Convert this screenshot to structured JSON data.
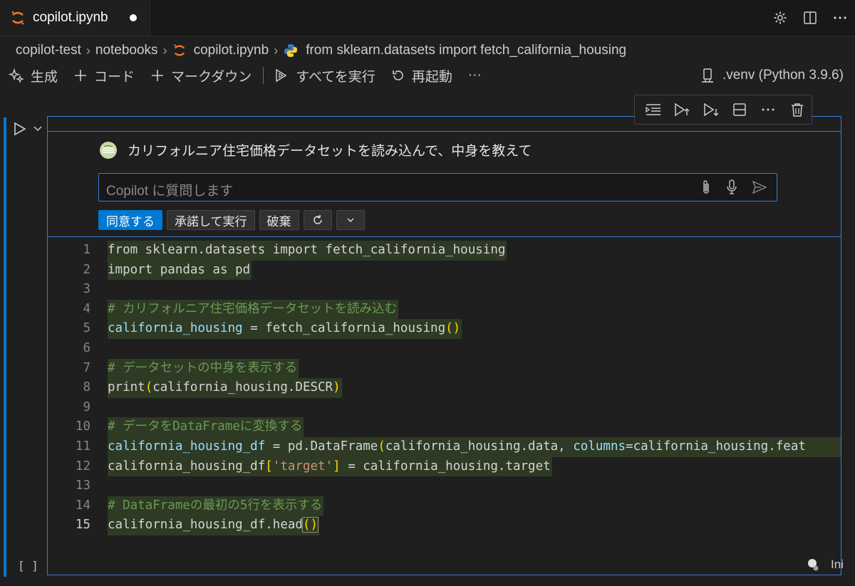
{
  "tab": {
    "title": "copilot.ipynb"
  },
  "breadcrumb": {
    "items": [
      "copilot-test",
      "notebooks",
      "copilot.ipynb",
      "from sklearn.datasets import fetch_california_housing"
    ]
  },
  "toolbar": {
    "generate": "生成",
    "code": "コード",
    "markdown": "マークダウン",
    "run_all": "すべてを実行",
    "restart": "再起動",
    "more": "···"
  },
  "kernel": {
    "label": ".venv (Python 3.9.6)"
  },
  "inline_chat": {
    "prompt": "カリフォルニア住宅価格データセットを読み込んで、中身を教えて",
    "input_placeholder": "Copilot に質問します",
    "accept_label": "同意する",
    "accept_run_label": "承諾して実行",
    "discard_label": "破棄"
  },
  "code": {
    "line_numbers": [
      "1",
      "2",
      "3",
      "4",
      "5",
      "6",
      "7",
      "8",
      "9",
      "10",
      "11",
      "12",
      "13",
      "14",
      "15"
    ],
    "line1": "from sklearn.datasets import fetch_california_housing",
    "line2": "import pandas as pd",
    "line4": "# カリフォルニア住宅価格データセットを読み込む",
    "line5_var": "california_housing",
    "line5_rest": " = fetch_california_housing",
    "line7": "# データセットの中身を表示する",
    "line8_fn": "print",
    "line8_arg": "california_housing.DESCR",
    "line10": "# データをDataFrameに変換する",
    "line11_var": "california_housing_df",
    "line11_mid": " = pd.DataFrame",
    "line11_arg": "california_housing.data, ",
    "line11_kw": "columns",
    "line11_tail": "=california_housing.feat",
    "line12_a": "california_housing_df",
    "line12_str": "'target'",
    "line12_b": " = california_housing.target",
    "line14": "# DataFrameの最初の5行を表示する",
    "line15": "california_housing_df.head"
  },
  "cell_status": "[ ]",
  "language_label": "Ini"
}
